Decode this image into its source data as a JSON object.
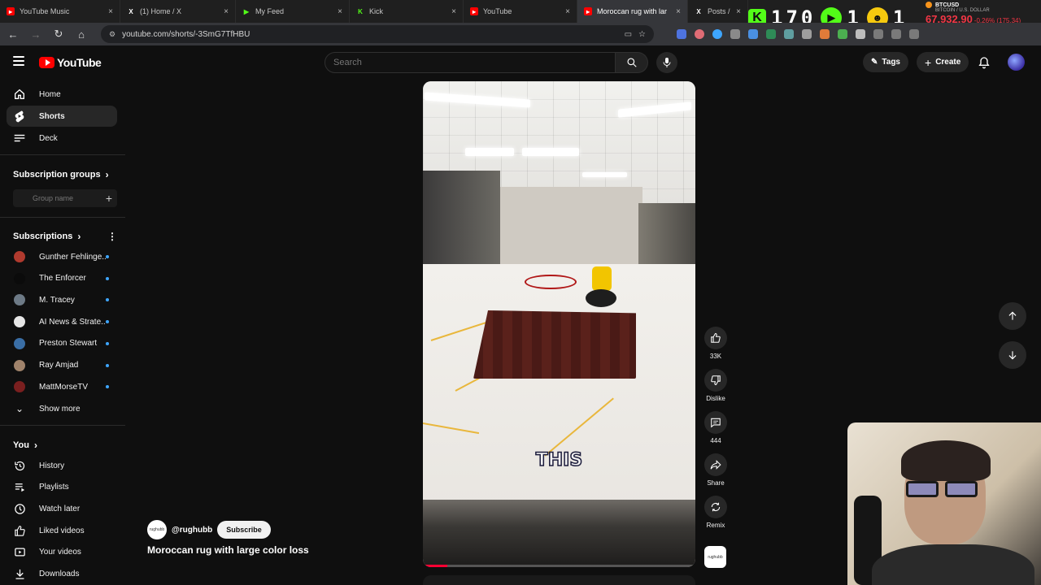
{
  "browser": {
    "tabs": [
      {
        "label": "YouTube Music",
        "icon": "youtube-music-icon",
        "color": "#ff0000",
        "active": false
      },
      {
        "label": "(1) Home / X",
        "icon": "x-icon",
        "color": "#ffffff",
        "active": false
      },
      {
        "label": "My Feed",
        "icon": "my-feed-icon",
        "color": "#53fc18",
        "active": false
      },
      {
        "label": "Kick",
        "icon": "kick-icon",
        "color": "#53fc18",
        "active": false
      },
      {
        "label": "YouTube",
        "icon": "youtube-icon",
        "color": "#ff0000",
        "active": false
      },
      {
        "label": "Moroccan rug with lar",
        "icon": "youtube-icon",
        "color": "#ff0000",
        "active": true
      },
      {
        "label": "Posts / X",
        "icon": "x-icon",
        "color": "#ffffff",
        "active": false
      }
    ],
    "url": "youtube.com/shorts/-3SmG7TfHBU",
    "overlay_counter": "170",
    "overlay_count_a": "1",
    "overlay_count_b": "1"
  },
  "ticker": {
    "symbol": "BTCUSD",
    "name": "BITCOIN / U.S. DOLLAR",
    "price": "67,932.90",
    "change": "-0.26% (175.34)",
    "color_down": "#f23645"
  },
  "header": {
    "logo_text": "YouTube",
    "search_placeholder": "Search",
    "tags_label": "Tags",
    "create_label": "Create"
  },
  "sidebar": {
    "main": [
      {
        "label": "Home",
        "icon": "home-icon"
      },
      {
        "label": "Shorts",
        "icon": "shorts-icon"
      },
      {
        "label": "Deck",
        "icon": "deck-icon"
      }
    ],
    "subscription_groups_title": "Subscription groups",
    "group_name_placeholder": "Group name",
    "subscriptions_title": "Subscriptions",
    "subscriptions": [
      {
        "label": "Gunther Fehlinge...",
        "avatar_color": "#b03a2e"
      },
      {
        "label": "The Enforcer",
        "avatar_color": "#0b0b0b"
      },
      {
        "label": "M. Tracey",
        "avatar_color": "#6d7a86"
      },
      {
        "label": "AI News & Strate...",
        "avatar_color": "#e6e6e6"
      },
      {
        "label": "Preston Stewart",
        "avatar_color": "#3a6ea5"
      },
      {
        "label": "Ray Amjad",
        "avatar_color": "#a0836b"
      },
      {
        "label": "MattMorseTV",
        "avatar_color": "#7a1f1f"
      }
    ],
    "show_more": "Show more",
    "you_title": "You",
    "you_items": [
      {
        "label": "History",
        "icon": "history-icon"
      },
      {
        "label": "Playlists",
        "icon": "playlists-icon"
      },
      {
        "label": "Watch later",
        "icon": "watch-later-icon"
      },
      {
        "label": "Liked videos",
        "icon": "liked-videos-icon"
      },
      {
        "label": "Your videos",
        "icon": "your-videos-icon"
      },
      {
        "label": "Downloads",
        "icon": "downloads-icon"
      }
    ]
  },
  "short": {
    "caption_word": "THIS",
    "channel_handle": "@rughubb",
    "subscribe_label": "Subscribe",
    "title": "Moroccan rug with large color loss",
    "progress": 0.09
  },
  "actions": {
    "like_count": "33K",
    "dislike_label": "Dislike",
    "comment_count": "444",
    "share_label": "Share",
    "remix_label": "Remix"
  }
}
